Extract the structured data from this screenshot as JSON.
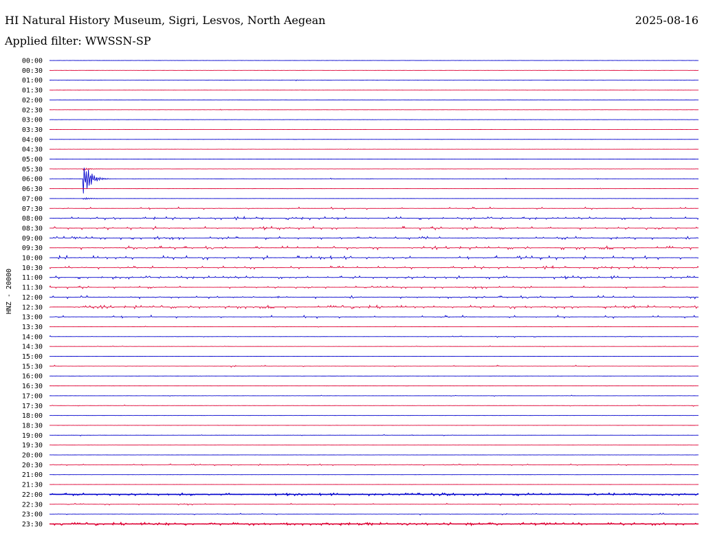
{
  "header": {
    "station": "HI Natural History Museum, Sigri, Lesvos, North Aegean",
    "date": "2025-08-16",
    "filter": "Applied filter: WWSSN-SP"
  },
  "colors": {
    "blue": "#0000cc",
    "red": "#dd0033"
  },
  "chart_data": {
    "type": "line",
    "title": "HI Natural History Museum, Sigri, Lesvos, North Aegean",
    "ylabel": "HNZ - 20000",
    "date": "2025-08-16",
    "row_labels": [
      "00:00",
      "00:30",
      "01:00",
      "01:30",
      "02:00",
      "02:30",
      "03:00",
      "03:30",
      "04:00",
      "04:30",
      "05:00",
      "05:30",
      "06:00",
      "06:30",
      "07:00",
      "07:30",
      "08:00",
      "08:30",
      "09:00",
      "09:30",
      "10:00",
      "10:30",
      "11:00",
      "11:30",
      "12:00",
      "12:30",
      "13:00",
      "13:30",
      "14:00",
      "14:30",
      "15:00",
      "15:30",
      "16:00",
      "16:30",
      "17:00",
      "17:30",
      "18:00",
      "18:30",
      "19:00",
      "19:30",
      "20:00",
      "20:30",
      "21:00",
      "21:30",
      "22:00",
      "22:30",
      "23:00",
      "23:30"
    ],
    "minutes_per_row": 30,
    "row_colors": [
      "blue",
      "red"
    ],
    "bursts": [
      {
        "row": 2,
        "minute": 11.4,
        "amp": 1.2
      },
      {
        "row": 5,
        "minute": 7.9,
        "amp": 0.8
      },
      {
        "row": 9,
        "minute": 13.8,
        "amp": 0.8
      },
      {
        "row": 11,
        "minute": 1.6,
        "amp": 2.0,
        "quake": true
      },
      {
        "row": 12,
        "minute": 1.6,
        "amp": 26,
        "quake": true
      },
      {
        "row": 12,
        "minute": 13.0,
        "amp": 1.2
      },
      {
        "row": 12,
        "minute": 21.1,
        "amp": 1.0
      },
      {
        "row": 12,
        "minute": 25.3,
        "amp": 1.0
      },
      {
        "row": 13,
        "minute": 25.5,
        "amp": 1.0
      },
      {
        "row": 14,
        "minute": 1.6,
        "amp": 2.0,
        "quake": true
      }
    ],
    "active_rows": [
      {
        "row": 15,
        "level": 2.0,
        "density": 0.28
      },
      {
        "row": 16,
        "level": 2.2,
        "density": 0.6
      },
      {
        "row": 17,
        "level": 2.5,
        "density": 0.45
      },
      {
        "row": 18,
        "level": 2.2,
        "density": 0.6
      },
      {
        "row": 19,
        "level": 2.5,
        "density": 0.45
      },
      {
        "row": 20,
        "level": 2.8,
        "density": 0.45
      },
      {
        "row": 21,
        "level": 2.2,
        "density": 0.5
      },
      {
        "row": 22,
        "level": 2.3,
        "density": 0.7
      },
      {
        "row": 23,
        "level": 2.0,
        "density": 0.35
      },
      {
        "row": 24,
        "level": 2.2,
        "density": 0.35
      },
      {
        "row": 25,
        "level": 2.3,
        "density": 0.6
      },
      {
        "row": 26,
        "level": 2.3,
        "density": 0.25
      },
      {
        "row": 27,
        "level": 0.8,
        "density": 0.05
      },
      {
        "row": 28,
        "level": 1.2,
        "density": 0.1
      },
      {
        "row": 29,
        "level": 0.8,
        "density": 0.05
      },
      {
        "row": 31,
        "level": 1.5,
        "density": 0.08
      },
      {
        "row": 34,
        "level": 0.8,
        "density": 0.05
      },
      {
        "row": 35,
        "level": 1.0,
        "density": 0.05
      },
      {
        "row": 38,
        "level": 1.0,
        "density": 0.05
      },
      {
        "row": 41,
        "level": 1.3,
        "density": 0.4
      },
      {
        "row": 44,
        "level": 1.5,
        "density": 0.8
      },
      {
        "row": 45,
        "level": 1.3,
        "density": 0.2
      },
      {
        "row": 46,
        "level": 1.2,
        "density": 0.1
      },
      {
        "row": 47,
        "level": 1.6,
        "density": 0.9
      }
    ]
  }
}
